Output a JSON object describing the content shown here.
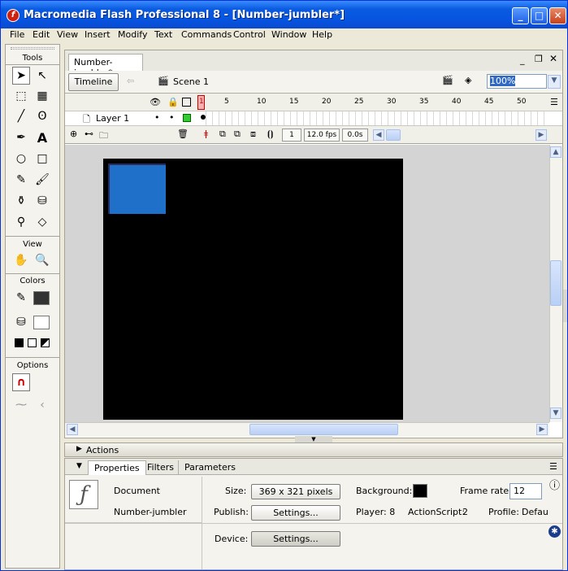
{
  "window": {
    "title": "Macromedia Flash Professional 8 - [Number-jumbler*]",
    "app_icon": "f"
  },
  "menu": [
    "File",
    "Edit",
    "View",
    "Insert",
    "Modify",
    "Text",
    "Commands",
    "Control",
    "Window",
    "Help"
  ],
  "tools": {
    "title": "Tools",
    "view_title": "View",
    "colors_title": "Colors",
    "options_title": "Options"
  },
  "document": {
    "tab_label": "Number-jumbler*",
    "timeline_button": "Timeline",
    "scene_label": "Scene 1",
    "zoom_value": "100%"
  },
  "timeline": {
    "frame_numbers": [
      "1",
      "5",
      "10",
      "15",
      "20",
      "25",
      "30",
      "35",
      "40",
      "45",
      "50"
    ],
    "layer_name": "Layer 1",
    "current_frame": "1",
    "fps": "12.0 fps",
    "elapsed": "0.0s"
  },
  "panels": {
    "actions_label": "Actions",
    "tabs": [
      "Properties",
      "Filters",
      "Parameters"
    ]
  },
  "properties": {
    "doc_type": "Document",
    "doc_name": "Number-jumbler",
    "size_label": "Size:",
    "size_value": "369 x 321 pixels",
    "publish_label": "Publish:",
    "settings_button": "Settings...",
    "device_label": "Device:",
    "device_button": "Settings...",
    "background_label": "Background:",
    "frame_rate_label": "Frame rate:",
    "frame_rate_value": "12",
    "player_label": "Player: 8",
    "actionscript_label": "ActionScript:",
    "actionscript_value": "2",
    "profile_label": "Profile:",
    "profile_value": "Defau"
  },
  "colors": {
    "stage": "#000000",
    "shape": "#1e70c8",
    "titlebar": "#0654e0"
  }
}
